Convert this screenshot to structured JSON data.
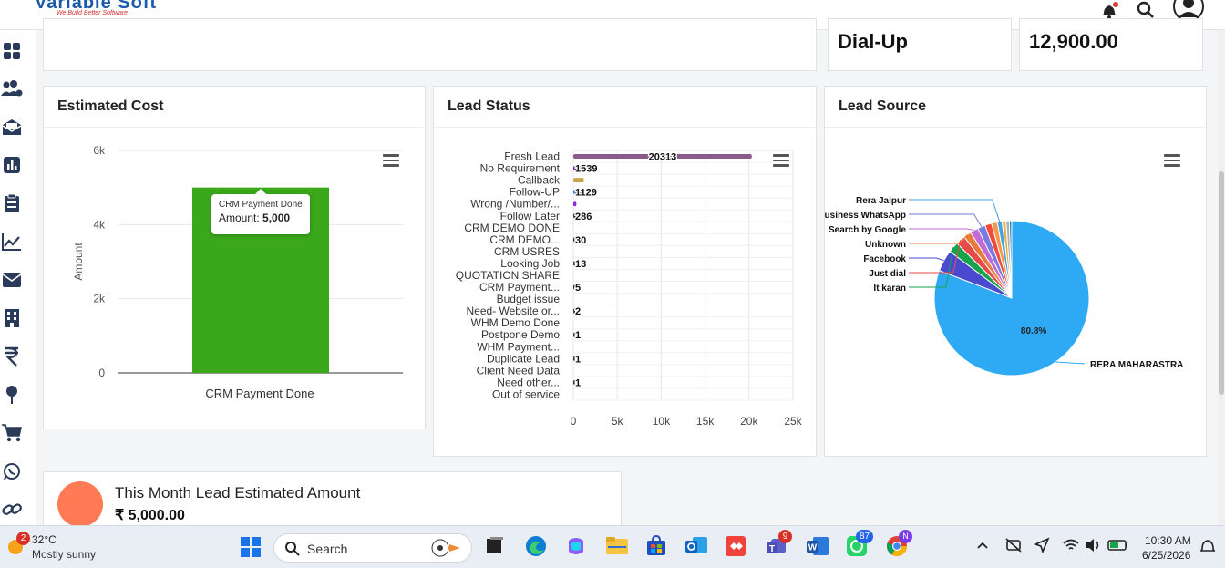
{
  "app": {
    "brand": "Variable Soft",
    "tagline": "We Build Better Software"
  },
  "top_stats": [
    {
      "value": "Dial-Up"
    },
    {
      "value": "12,900.00"
    }
  ],
  "estimated_cost": {
    "title": "Estimated Cost",
    "tooltip": {
      "category": "CRM Payment Done",
      "label": "Amount:",
      "value": "5,000"
    },
    "chart_data": {
      "type": "bar",
      "categories": [
        "CRM Payment Done"
      ],
      "values": [
        5000
      ],
      "ylabel": "Amount",
      "ylim": [
        0,
        6000
      ],
      "yticks": [
        "0",
        "2k",
        "4k",
        "6k"
      ],
      "color": "#3aa81a"
    }
  },
  "lead_status": {
    "title": "Lead Status",
    "chart_data": {
      "type": "bar",
      "orientation": "horizontal",
      "categories": [
        "Fresh Lead",
        "No Requirement",
        "Callback",
        "Follow-UP",
        "Wrong /Number/...",
        "Follow Later",
        "CRM DEMO DONE",
        "CRM DEMO...",
        "CRM USRES",
        "Looking Job",
        "QUOTATION SHARE",
        "CRM Payment...",
        "Budget issue",
        "Need- Website or...",
        "WHM Demo Done",
        "Postpone Demo",
        "WHM Payment...",
        "Duplicate Lead",
        "Client Need Data",
        "Need other...",
        "Out of service"
      ],
      "values": [
        20313,
        1539,
        1200,
        1129,
        350,
        286,
        0,
        30,
        0,
        13,
        0,
        5,
        0,
        2,
        0,
        1,
        0,
        1,
        0,
        1,
        0
      ],
      "labels": [
        "20313",
        "1539",
        "",
        "1129",
        "",
        "286",
        "",
        "30",
        "",
        "13",
        "",
        "5",
        "",
        "2",
        "",
        "1",
        "",
        "1",
        "",
        "1",
        ""
      ],
      "colors": [
        "#8a5a8a",
        "#6a1a8a",
        "#c9a44a",
        "#3a6ad0",
        "#8a2ae0",
        "#333",
        "#333",
        "#333",
        "#333",
        "#333",
        "#333",
        "#333",
        "#333",
        "#333",
        "#333",
        "#333",
        "#333",
        "#333",
        "#333",
        "#333",
        "#333"
      ],
      "xlim": [
        0,
        25000
      ],
      "xticks": [
        "0",
        "5k",
        "10k",
        "15k",
        "20k",
        "25k"
      ]
    }
  },
  "lead_source": {
    "title": "Lead Source",
    "chart_data": {
      "type": "pie",
      "slices": [
        {
          "name": "RERA MAHARASTRA",
          "value": 80.8,
          "color": "#2eaaf5",
          "label": "80.8%"
        },
        {
          "name": "Facebook",
          "value": 4.5,
          "color": "#4a4ad0",
          "label": ""
        },
        {
          "name": "It karan",
          "value": 2.2,
          "color": "#16a34a",
          "label": ""
        },
        {
          "name": "Just dial",
          "value": 2.0,
          "color": "#e84a4a",
          "label": ""
        },
        {
          "name": "Unknown",
          "value": 1.6,
          "color": "#ea7a3a",
          "label": ""
        },
        {
          "name": "Search by Google",
          "value": 1.7,
          "color": "#c06ad8",
          "label": ""
        },
        {
          "name": "Business WhatsApp",
          "value": 1.6,
          "color": "#7a7adf",
          "label": ""
        },
        {
          "name": "",
          "value": 1.4,
          "color": "#f24a3a",
          "label": ""
        },
        {
          "name": "",
          "value": 1.2,
          "color": "#f29a4a",
          "label": ""
        },
        {
          "name": "Rera Jaipur",
          "value": 1.0,
          "color": "#4aa0e0",
          "label": ""
        },
        {
          "name": "",
          "value": 0.8,
          "color": "#e0b84a",
          "label": ""
        },
        {
          "name": "",
          "value": 0.7,
          "color": "#b0b0b0",
          "label": ""
        },
        {
          "name": "",
          "value": 0.5,
          "color": "#2a8ac0",
          "label": ""
        }
      ]
    }
  },
  "month_estimate": {
    "title": "This Month Lead Estimated Amount",
    "amount": "₹ 5,000.00"
  },
  "taskbar": {
    "weather": {
      "temp": "32°C",
      "desc": "Mostly sunny",
      "badge": "2"
    },
    "search_placeholder": "Search",
    "teams_badge": "9",
    "whatsapp_badge": "87",
    "chrome_badge": "N",
    "time": "10:30 AM",
    "date": "6/25/2026"
  },
  "sidebar_icons": [
    "dashboard-icon",
    "users-icon",
    "inbox-icon",
    "reports-icon",
    "clipboard-icon",
    "analytics-icon",
    "mail-icon",
    "building-icon",
    "rupee-icon",
    "pin-icon",
    "cart-icon",
    "whatsapp-icon",
    "link-icon"
  ]
}
